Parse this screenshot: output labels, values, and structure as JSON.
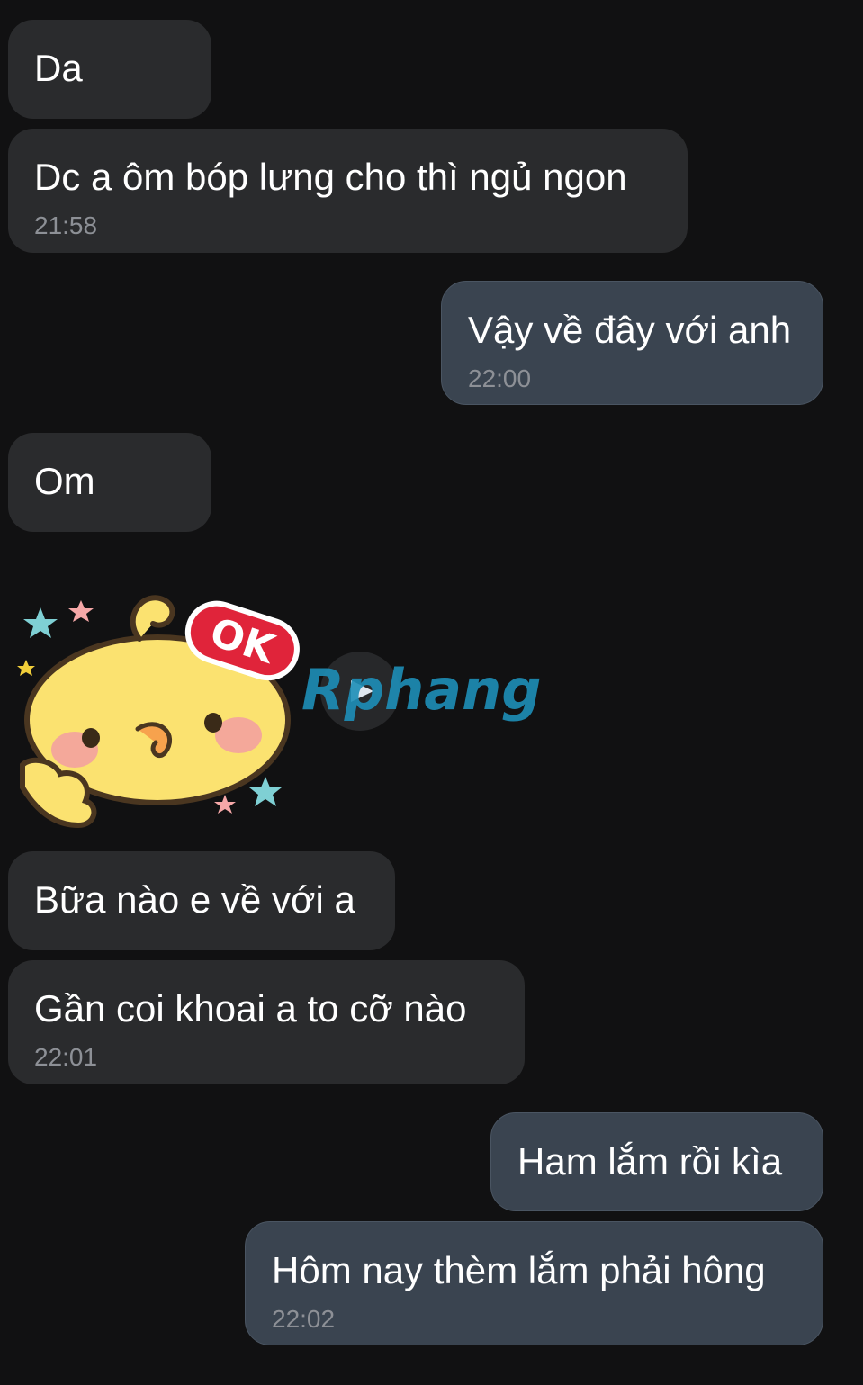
{
  "messages": [
    {
      "id": "m1",
      "dir": "in",
      "text": "Da",
      "time": ""
    },
    {
      "id": "m2",
      "dir": "in",
      "text": "Dc a ôm bóp lưng cho thì ngủ ngon",
      "time": "21:58"
    },
    {
      "id": "m3",
      "dir": "out",
      "text": "Vậy về đây với anh",
      "time": "22:00"
    },
    {
      "id": "m4",
      "dir": "in",
      "text": "Om",
      "time": ""
    },
    {
      "id": "m5",
      "dir": "in",
      "text": "Bữa nào e về với a",
      "time": ""
    },
    {
      "id": "m6",
      "dir": "in",
      "text": "Gần coi khoai a to cỡ nào",
      "time": "22:01"
    },
    {
      "id": "m7",
      "dir": "out",
      "text": "Ham lắm rồi kìa",
      "time": ""
    },
    {
      "id": "m8",
      "dir": "out",
      "text": "Hôm nay thèm lắm phải hông",
      "time": "22:02"
    }
  ],
  "sticker": {
    "badge": "OK",
    "icon": "chick-ok-sticker"
  },
  "watermark": {
    "text": "Rphang",
    "icon": "play-icon"
  },
  "colors": {
    "background": "#111112",
    "incoming_bubble": "#2a2b2d",
    "outgoing_bubble": "#3a4450",
    "timestamp": "#8d9096",
    "text": "#ffffff"
  }
}
